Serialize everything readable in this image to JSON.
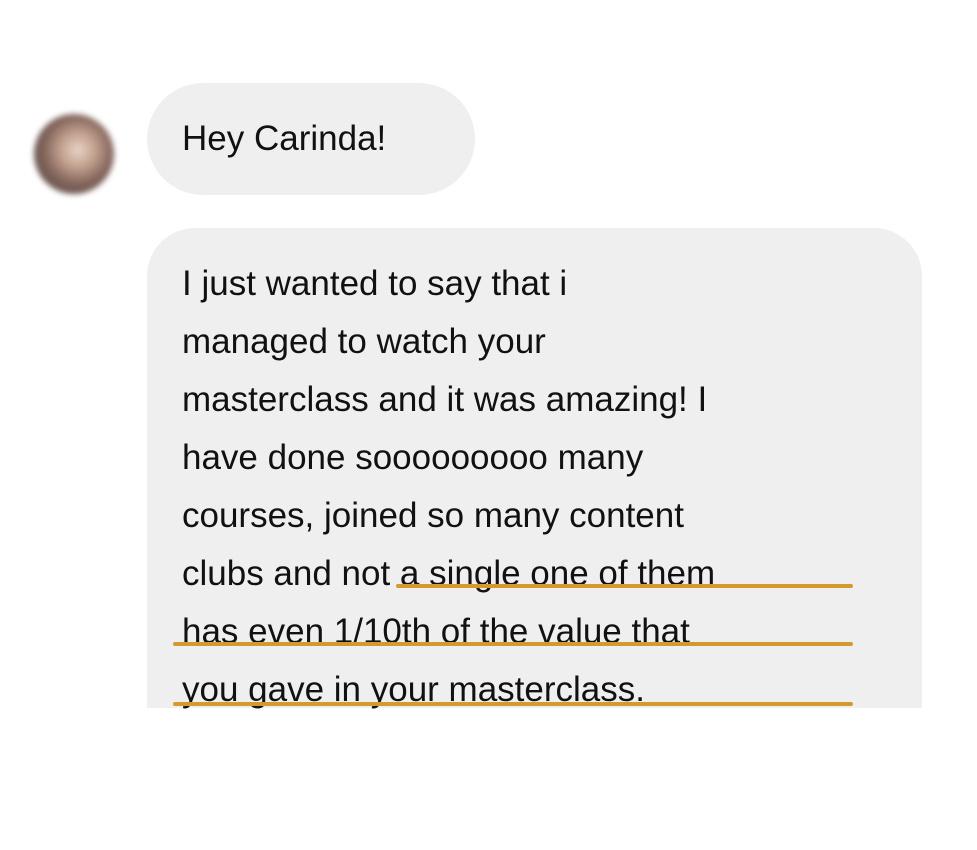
{
  "conversation": {
    "sender_avatar_icon": "avatar-photo-blurred",
    "highlight_color": "#d49a2e",
    "bubble_color": "#efefef",
    "messages": [
      {
        "lines": [
          "Hey Carinda!"
        ]
      },
      {
        "lines": [
          "I just wanted to say that i",
          "managed to watch your",
          "masterclass and it was amazing! I",
          "have done sooooooooo many",
          "courses, joined so many content",
          "clubs and not a single one of them",
          "has even 1/10th of the value that",
          "you gave in your masterclass."
        ]
      }
    ]
  }
}
